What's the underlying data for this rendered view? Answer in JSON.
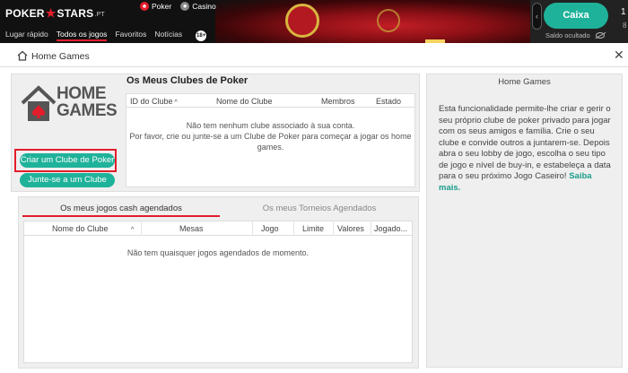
{
  "header": {
    "logo_left": "POKER",
    "logo_right": "STARS",
    "logo_suffix": ".PT",
    "product_tabs": [
      "Poker",
      "Casino"
    ],
    "nav": [
      "Lugar rápido",
      "Todos os jogos",
      "Favoritos",
      "Notícias"
    ],
    "active_nav": "Todos os jogos",
    "age_badge": "18+",
    "cashier_label": "Caixa",
    "balance_label": "Saldo ocultado",
    "balance_partial": "1",
    "balance_partial2": "8"
  },
  "window": {
    "title": "Home Games"
  },
  "clubs": {
    "logo_line1": "HOME",
    "logo_line2": "GAMES",
    "create_button": "Criar um Clube de Poker",
    "join_button": "Junte-se a um Clube",
    "section_title": "Os Meus Clubes de Poker",
    "columns": [
      "ID do Clube",
      "Nome do Clube",
      "Membros",
      "Estado"
    ],
    "empty_line1": "Não tem nenhum clube associado à sua conta.",
    "empty_line2": "Por favor, crie ou junte-se a um Clube de Poker para começar a jogar os home",
    "empty_line3": "games."
  },
  "games": {
    "tabs": [
      "Os meus jogos cash agendados",
      "Os meus Torneios Agendados"
    ],
    "active_tab": "Os meus jogos cash agendados",
    "columns": [
      "Nome do Clube",
      "Mesas",
      "Jogo",
      "Limite",
      "Valores",
      "Jogado..."
    ],
    "empty_message": "Não tem quaisquer jogos agendados de momento."
  },
  "info": {
    "title": "Home Games",
    "body": "Esta funcionalidade permite-lhe criar e gerir o seu próprio clube de poker privado para jogar com os seus amigos e família. Crie o seu clube e convide outros a juntarem-se. Depois abra o seu lobby de jogo, escolha o seu tipo de jogo e nível de buy-in, e estabeleça a data para o seu próximo Jogo Caseiro!",
    "link": "Saiba mais."
  },
  "colors": {
    "accent_green": "#1fb29a",
    "brand_red": "#e31d2b",
    "topbar": "#111111"
  }
}
